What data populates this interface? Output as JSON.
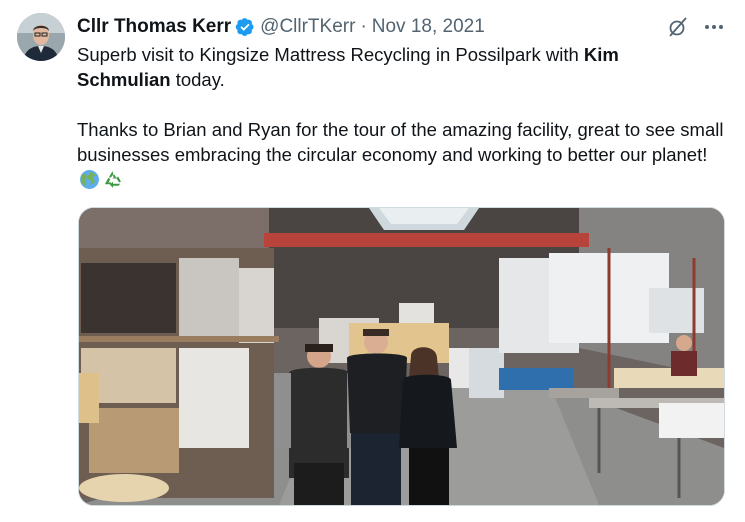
{
  "author": {
    "name": "Cllr Thomas Kerr",
    "handle": "@CllrTKerr",
    "separator": "·",
    "date": "Nov 18, 2021",
    "verified": true,
    "avatar_icon": "avatar-photo",
    "verified_color": "#1d9bf0"
  },
  "tweet": {
    "line1_prefix": "Superb visit to Kingsize Mattress Recycling in Possilpark with ",
    "mention_first": "Kim",
    "mention_second": "Schmulian",
    "line1_suffix": " today.",
    "para2": "Thanks to Brian and Ryan for the tour of the amazing facility, great to see small businesses embracing the circular economy and working to better our planet!",
    "emojis": [
      "globe-emoji",
      "recycle-emoji"
    ]
  },
  "actions": {
    "grok_icon": "grok-icon",
    "more_icon": "more-icon"
  },
  "media": {
    "alt_icon": "photo-mattress-warehouse"
  }
}
